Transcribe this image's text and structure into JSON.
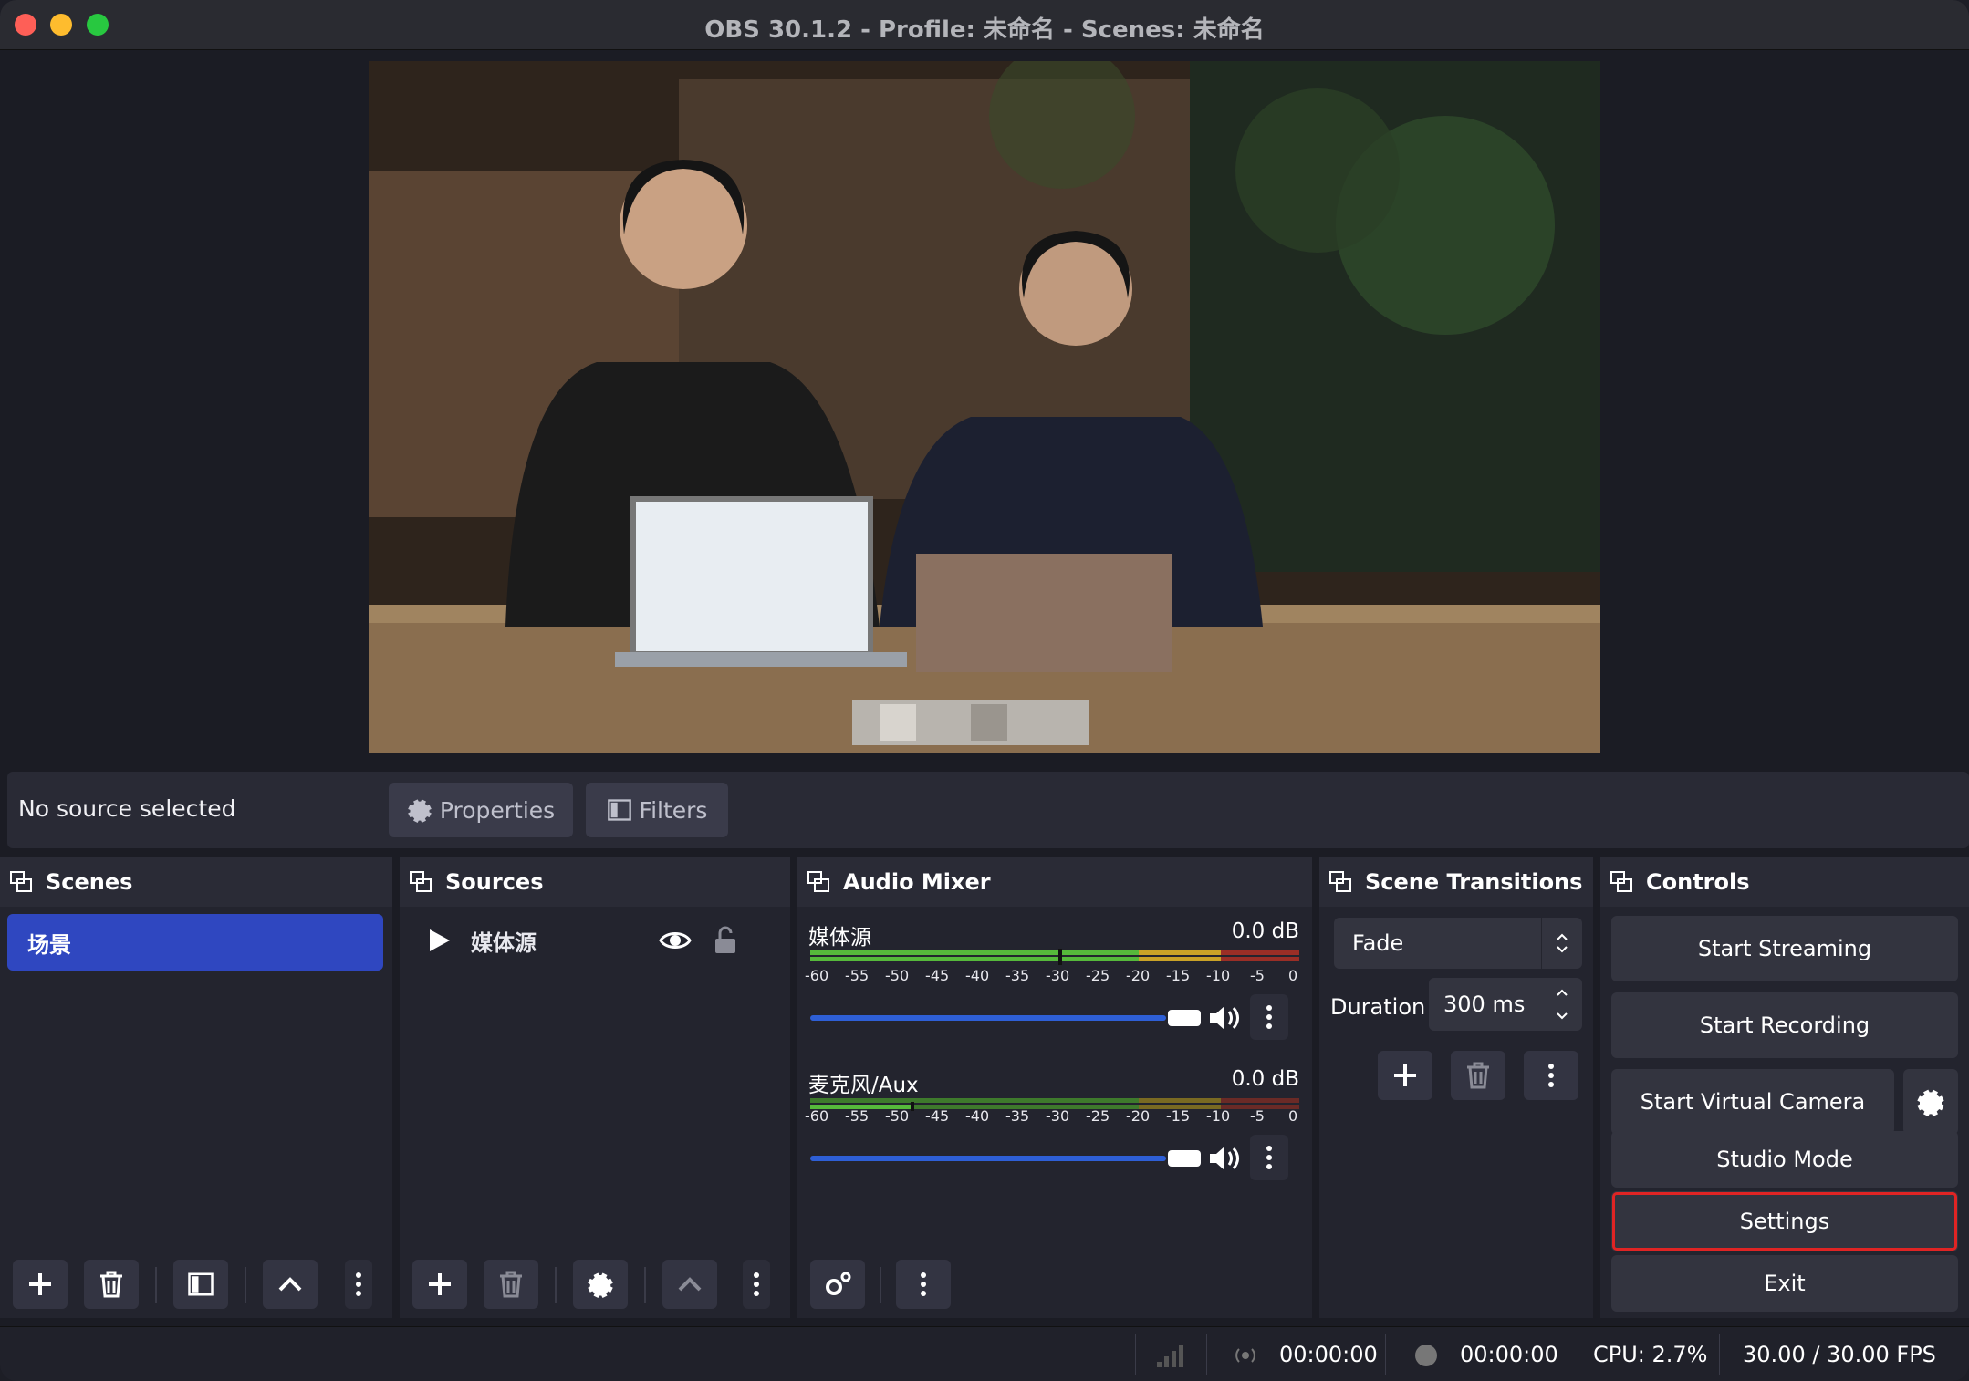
{
  "window": {
    "title": "OBS 30.1.2 - Profile: 未命名 - Scenes: 未命名"
  },
  "context_bar": {
    "status": "No source selected",
    "properties_label": "Properties",
    "filters_label": "Filters"
  },
  "scenes": {
    "title": "Scenes",
    "items": [
      {
        "label": "场景",
        "selected": true
      }
    ]
  },
  "sources": {
    "title": "Sources",
    "items": [
      {
        "label": "媒体源",
        "visible": true,
        "locked": false
      }
    ]
  },
  "audio_mixer": {
    "title": "Audio Mixer",
    "channels": [
      {
        "name": "媒体源",
        "db": "0.0 dB"
      },
      {
        "name": "麦克风/Aux",
        "db": "0.0 dB"
      }
    ],
    "ticks": [
      "-60",
      "-55",
      "-50",
      "-45",
      "-40",
      "-35",
      "-30",
      "-25",
      "-20",
      "-15",
      "-10",
      "-5",
      "0"
    ]
  },
  "scene_transitions": {
    "title": "Scene Transitions",
    "transition": "Fade",
    "duration_label": "Duration",
    "duration_value": "300 ms"
  },
  "controls": {
    "title": "Controls",
    "start_streaming": "Start Streaming",
    "start_recording": "Start Recording",
    "start_virtual_camera": "Start Virtual Camera",
    "studio_mode": "Studio Mode",
    "settings": "Settings",
    "exit": "Exit"
  },
  "status_bar": {
    "stream_time": "00:00:00",
    "record_time": "00:00:00",
    "cpu": "CPU: 2.7%",
    "fps": "30.00 / 30.00 FPS"
  },
  "colors": {
    "accent": "#2f47c0",
    "highlight": "#e02424",
    "meter_green": "#56b93b",
    "meter_yellow": "#c9a227",
    "meter_red": "#c0392b"
  }
}
